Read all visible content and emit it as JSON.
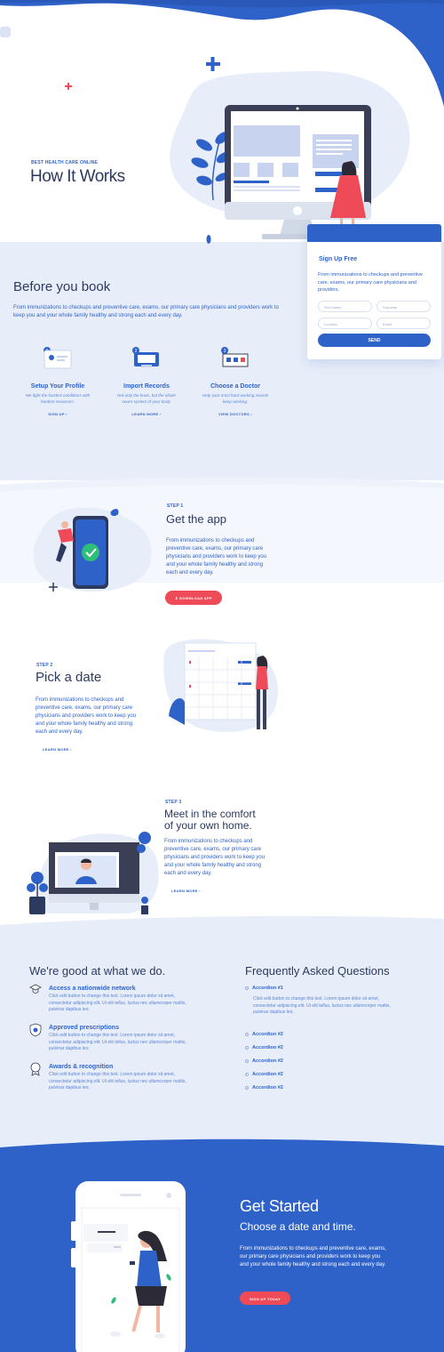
{
  "hero": {
    "eyebrow": "BEST HEALTH CARE ONLINE",
    "title": "How It Works"
  },
  "signup": {
    "title": "Sign Up Free",
    "text": "From immunizations to checkups and preventive care,  exams, our primary care physicians and providers.",
    "first_name_placeholder": "First Name",
    "surname_placeholder": "Surname",
    "location_placeholder": "Location",
    "email_placeholder": "Email",
    "send_label": "SEND"
  },
  "before": {
    "title": "Before you book",
    "text": "From immunizations to checkups and  preventive care,  exams, our primary care physicians and providers work to keep you and your whole family healthy and strong each and every day.",
    "steps": [
      {
        "num": "1",
        "title": "Setup Your Profile",
        "desc": "We fight the hardest conditions with hardest resources.",
        "link": "SIGN UP ›"
      },
      {
        "num": "2",
        "title": "Import Records",
        "desc": "Not only the brain, but the whole neuro-system of your body.",
        "link": "LEARN MORE ›"
      },
      {
        "num": "3",
        "title": "Choose a Doctor",
        "desc": "Help your most hard working muscle keep working.",
        "link": "VIEW DOCTORS ›"
      }
    ]
  },
  "step1": {
    "eyebrow": "STEP 1",
    "title": "Get the app",
    "text": "From immunizations to checkups and preventive care,  exams, our primary care physicians and providers work to keep you and your whole family healthy and strong each and every day.",
    "button": "⬇ DOWNLOAD APP"
  },
  "step2": {
    "eyebrow": "STEP 2",
    "title": "Pick a date",
    "text": "From immunizations to checkups and preventive care,  exams, our primary care physicians and providers work to keep you and your whole family healthy and strong each and every day.",
    "link": "LEARN MORE ›"
  },
  "step3": {
    "eyebrow": "STEP 3",
    "title_line1": "Meet in the comfort",
    "title_line2": "of your own home.",
    "text": "From immunizations to checkups and preventive care,  exams, our primary care physicians and providers work to keep you and your whole family healthy and strong each and every day.",
    "link": "LEARN MORE ›"
  },
  "good": {
    "title": "We're good at what we do.",
    "items": [
      {
        "title": "Access a nationwide network",
        "desc": "Click edit button to change this text. Lorem ipsum dolor sit amet, consectetur adipiscing elit. Ut elit tellus, luctus nec ullamcorper mattis, pulvinar dapibus leo."
      },
      {
        "title": "Approved prescriptions",
        "desc": "Click edit button to change this text. Lorem ipsum dolor sit amet, consectetur adipiscing elit. Ut elit tellus, luctus nec ullamcorper mattis, pulvinar dapibus leo."
      },
      {
        "title": "Awards & recognition",
        "desc": "Click edit button to change this text. Lorem ipsum dolor sit amet, consectetur adipiscing elit. Ut elit tellus, luctus nec ullamcorper mattis, pulvinar dapibus leo."
      }
    ]
  },
  "faq": {
    "title": "Frequently Asked Questions",
    "open_title": "Accordion #1",
    "open_text": "Click edit button to change this text. Lorem ipsum dolor sit amet, consectetur adipiscing elit. Ut elit tellus, luctus nec ullamcorper mattis, pulvinar dapibus leo.",
    "closed": [
      "Accordion #2",
      "Accordion #2",
      "Accordion #2",
      "Accordion #2",
      "Accordion #2"
    ]
  },
  "cta": {
    "title": "Get Started",
    "subtitle": "Choose a date and time.",
    "text": "From immunizations to checkups and  preventive care,  exams, our primary care physicians and providers work to keep you and your whole family healthy and strong each and every day.",
    "button": "SIGN UP TODAY"
  },
  "colors": {
    "brand_blue": "#2f62c9",
    "navy": "#2c3a60",
    "accent_red": "#ef4a58",
    "pale_blue": "#e8eef9"
  }
}
